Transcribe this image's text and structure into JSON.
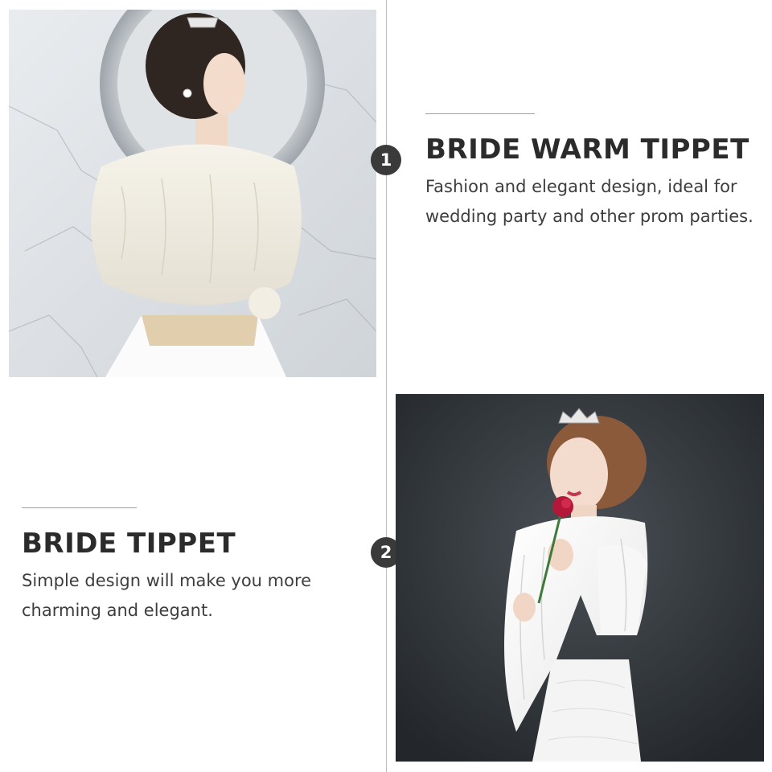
{
  "sections": [
    {
      "step": "1",
      "title": "BRIDE WARM TIPPET",
      "description": "Fashion and elegant design, ideal for wedding party and other prom parties."
    },
    {
      "step": "2",
      "title": "BRIDE TIPPET",
      "description": "Simple design will make you more charming and elegant."
    }
  ],
  "colors": {
    "timeline": "#bdbdbd",
    "step_dot": "#3a3a3a",
    "heading": "#2b2b2b",
    "body_text": "#3d3d3d"
  }
}
